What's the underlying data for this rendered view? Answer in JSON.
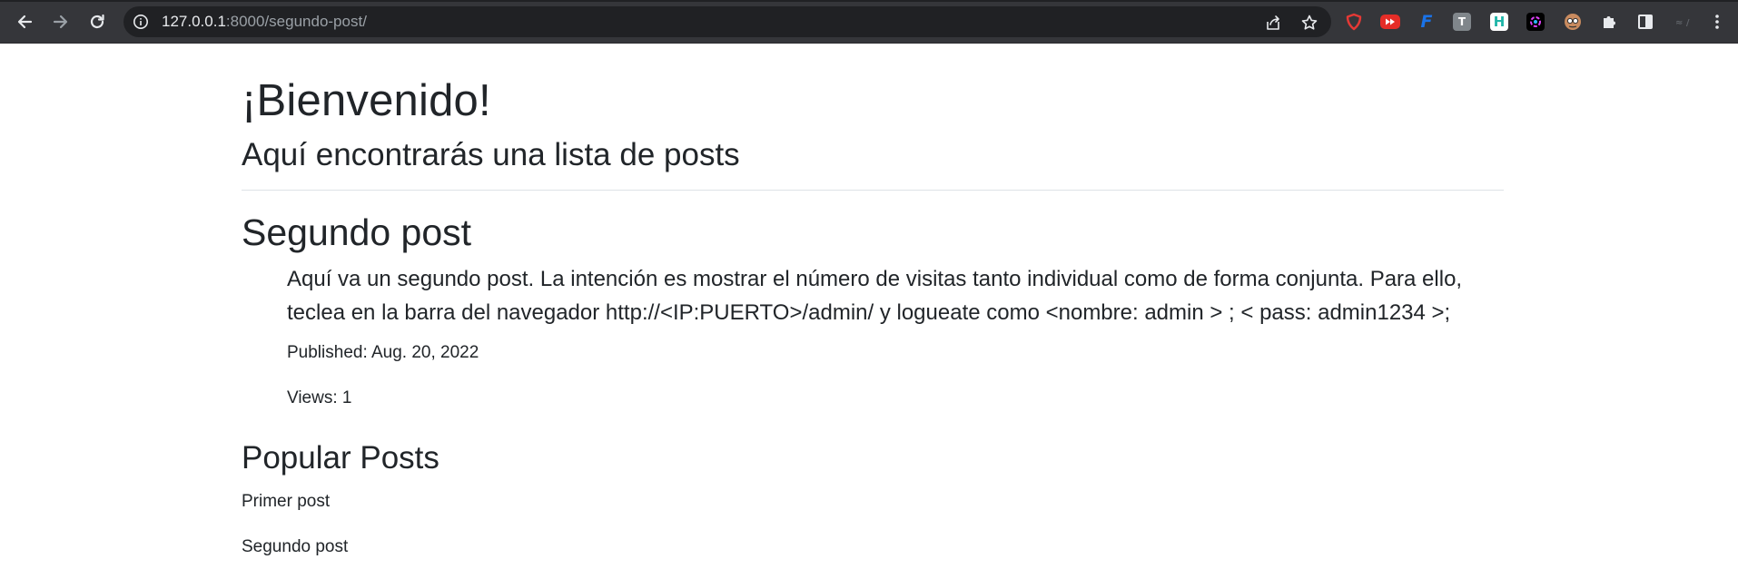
{
  "browser": {
    "url_host": "127.0.0.1",
    "url_path": ":8000/segundo-post/",
    "extensions": [
      {
        "icon": "shield-extension-icon",
        "color": "#e53935",
        "glyph": ""
      },
      {
        "icon": "youtube-extension-icon",
        "color": "#e52d27",
        "glyph": ""
      },
      {
        "icon": "f-extension-icon",
        "color": "#1a73e8",
        "glyph": "F"
      },
      {
        "icon": "t-extension-icon",
        "color": "#80868b",
        "glyph": "T"
      },
      {
        "icon": "h-extension-icon",
        "color": "#1fb5a8",
        "glyph": "H"
      },
      {
        "icon": "color-wheel-extension-icon",
        "color": "#000000",
        "glyph": ""
      },
      {
        "icon": "avatar-extension-icon",
        "color": "#a05a3c",
        "glyph": ""
      }
    ]
  },
  "header": {
    "welcome": "¡Bienvenido!",
    "subtitle": "Aquí encontrarás una lista de posts"
  },
  "post": {
    "title": "Segundo post",
    "body": "Aquí va un segundo post. La intención es mostrar el número de visitas tanto individual como de forma conjunta. Para ello, teclea en la barra del navegador http://<IP:PUERTO>/admin/ y logueate como <nombre: admin > ; < pass: admin1234 >;",
    "published": "Published: Aug. 20, 2022",
    "views": "Views: 1"
  },
  "popular": {
    "title": "Popular Posts",
    "items": [
      "Primer post",
      "Segundo post"
    ]
  },
  "colors": {
    "chrome_bg": "#35363a",
    "omnibox_bg": "#202124",
    "text": "#212529",
    "divider": "#dee2e6"
  }
}
